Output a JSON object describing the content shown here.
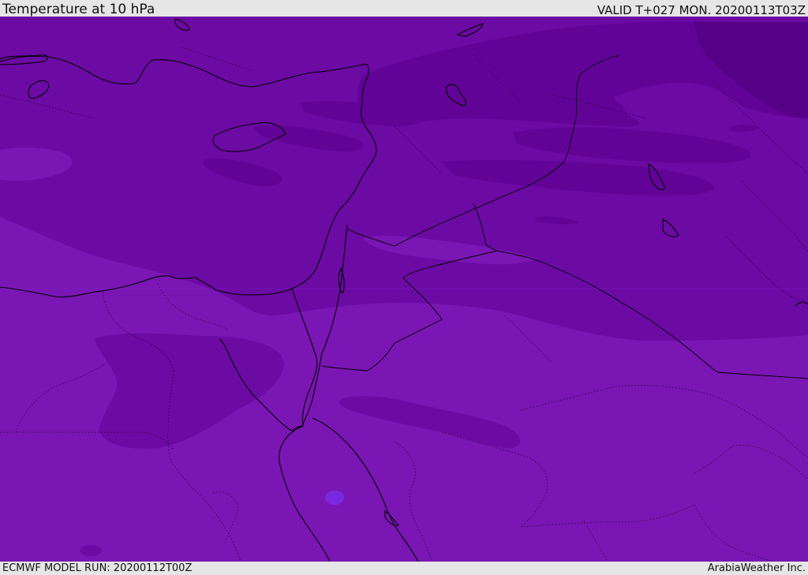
{
  "header": {
    "title": "Temperature at 10 hPa",
    "valid": "VALID T+027 MON. 20200113T03Z"
  },
  "footer": {
    "model_run": "ECMWF MODEL RUN: 20200112T00Z",
    "credit": "ArabiaWeather Inc."
  },
  "map": {
    "colors": {
      "warmest": "#7a16b4",
      "warm": "#6c0aa4",
      "mid": "#620398",
      "cold": "#560187",
      "highlight": "#8a2ad6",
      "spot": "#7a28e0",
      "coast": "#000000"
    }
  }
}
